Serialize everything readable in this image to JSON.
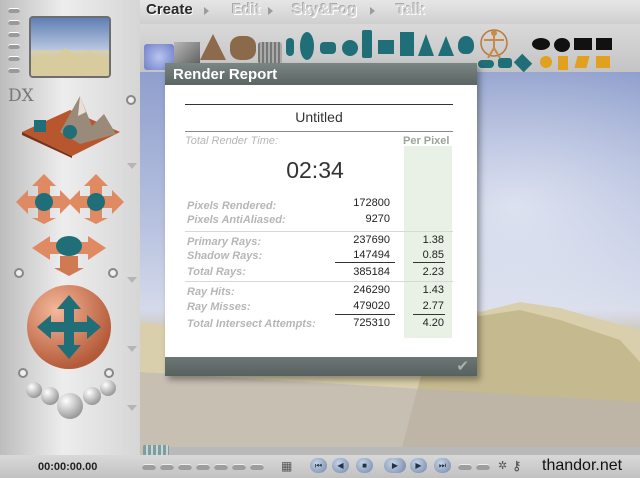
{
  "menu": {
    "create": "Create",
    "edit": "Edit",
    "sky_fog": "Sky&Fog",
    "talk": "Talk"
  },
  "report": {
    "title": "Render Report",
    "document_name": "Untitled",
    "total_render_time_label": "Total Render Time:",
    "per_pixel_label": "Per Pixel",
    "render_time": "02:34",
    "rows": {
      "pixels_rendered": {
        "label": "Pixels Rendered:",
        "value": "172800"
      },
      "pixels_antialiased": {
        "label": "Pixels AntiAliased:",
        "value": "9270"
      },
      "primary_rays": {
        "label": "Primary Rays:",
        "value": "237690",
        "per_pixel": "1.38"
      },
      "shadow_rays": {
        "label": "Shadow Rays:",
        "value": "147494",
        "per_pixel": "0.85"
      },
      "total_rays": {
        "label": "Total Rays:",
        "value": "385184",
        "per_pixel": "2.23"
      },
      "ray_hits": {
        "label": "Ray Hits:",
        "value": "246290",
        "per_pixel": "1.43"
      },
      "ray_misses": {
        "label": "Ray Misses:",
        "value": "479020",
        "per_pixel": "2.77"
      },
      "total_intersect": {
        "label": "Total Intersect Attempts:",
        "value": "725310",
        "per_pixel": "4.20"
      }
    },
    "done_icon": "check-icon"
  },
  "bottom": {
    "timecode": "00:00:00.00",
    "watermark": "thandor.net"
  },
  "colors": {
    "titlebar": "#6f7a78",
    "per_pixel_column": "#e9f1e7",
    "shape_teal": "#1f6e78",
    "menu_active": "#2a2a2a"
  }
}
